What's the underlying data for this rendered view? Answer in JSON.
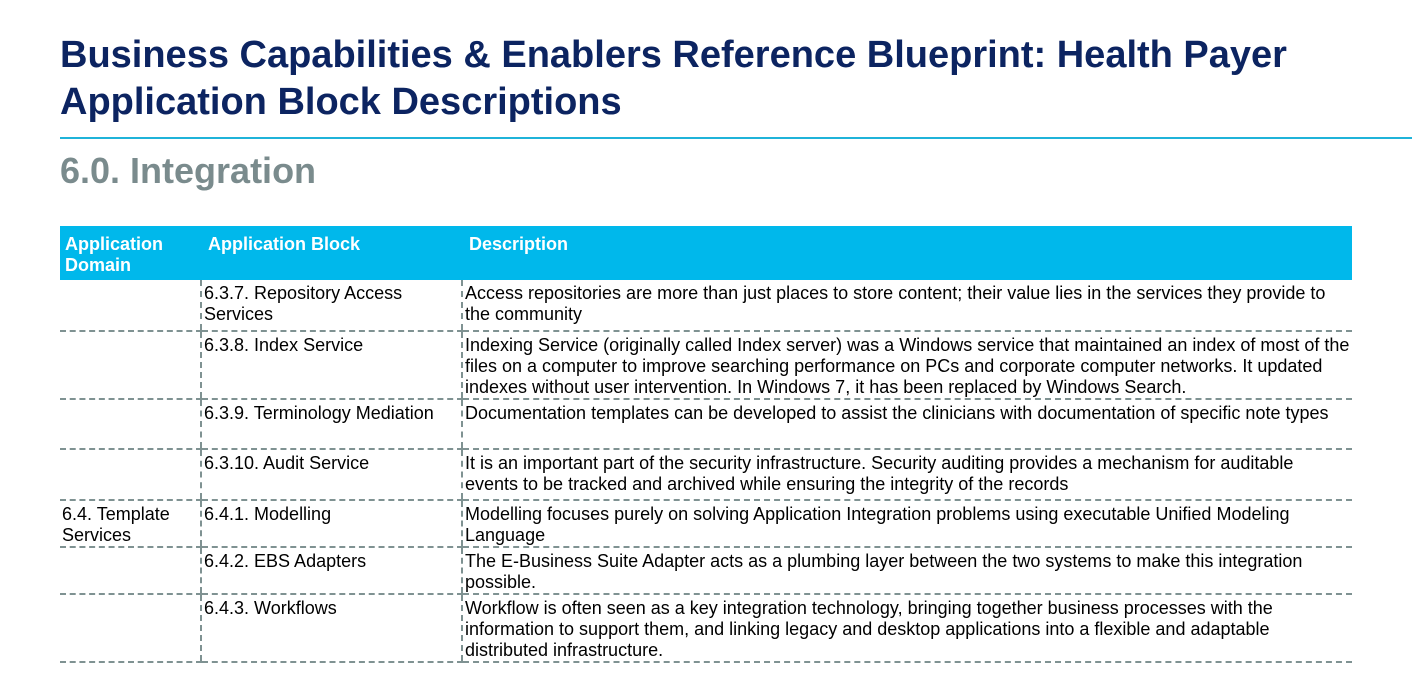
{
  "page": {
    "title": "Business Capabilities & Enablers Reference Blueprint: Health Payer Application Block Descriptions",
    "section_heading": "6.0. Integration"
  },
  "table": {
    "headers": {
      "domain": "Application Domain",
      "block": "Application Block",
      "description": "Description"
    },
    "rows": [
      {
        "domain": "",
        "block": "6.3.7. Repository Access Services",
        "description": "Access repositories are more than just places to store content; their value lies in the services they provide to the community"
      },
      {
        "domain": "",
        "block": "6.3.8. Index Service",
        "description": "Indexing Service (originally called Index server) was a Windows service that maintained an index of most of the files on a computer to improve searching performance on PCs and corporate computer networks. It updated indexes without user intervention. In Windows 7, it has been replaced by Windows Search."
      },
      {
        "domain": "",
        "block": "6.3.9. Terminology Mediation",
        "description": "Documentation templates can be developed to assist the clinicians with documentation of specific note types"
      },
      {
        "domain": "",
        "block": "6.3.10. Audit Service",
        "description": "It is an important part of the security infrastructure. Security auditing provides a mechanism for auditable events to be tracked and archived while ensuring the integrity of the records"
      },
      {
        "domain": "6.4. Template Services",
        "block": "6.4.1. Modelling",
        "description": "Modelling focuses purely on solving Application Integration problems using executable Unified Modeling Language"
      },
      {
        "domain": "",
        "block": "6.4.2. EBS Adapters",
        "description": "The E-Business Suite Adapter acts as a plumbing layer between the two systems to make this integration possible."
      },
      {
        "domain": "",
        "block": "6.4.3. Workflows",
        "description": "Workflow is often seen as a key integration technology, bringing together business processes with the information to support them, and linking legacy and desktop applications into a flexible and adaptable distributed infrastructure."
      }
    ]
  }
}
